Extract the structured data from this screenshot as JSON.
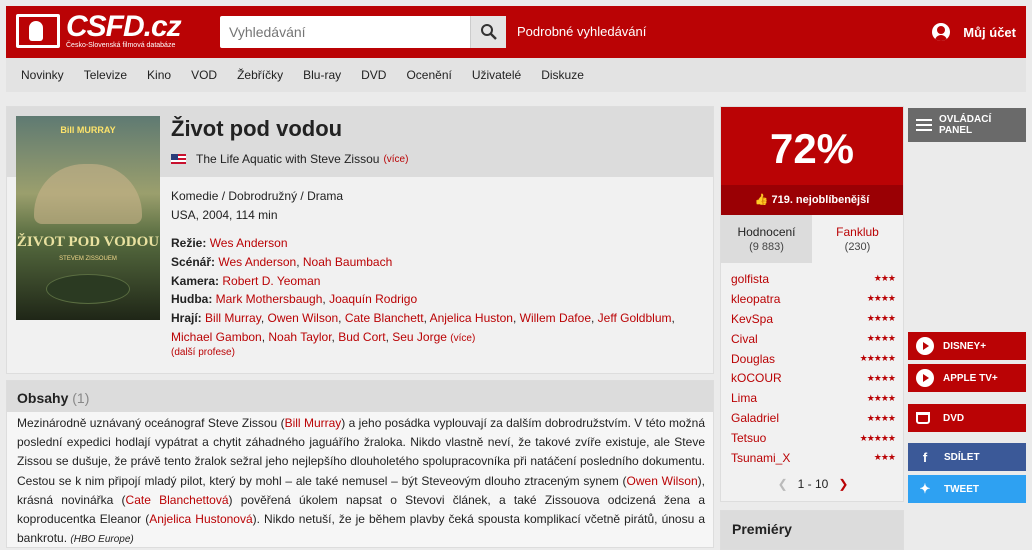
{
  "header": {
    "logo_text": "CSFD.cz",
    "logo_tagline": "Česko-Slovenská filmová databáze",
    "search_placeholder": "Vyhledávání",
    "advanced_search": "Podrobné vyhledávání",
    "account": "Můj účet",
    "accent_color": "#ba0305"
  },
  "nav": [
    "Novinky",
    "Televize",
    "Kino",
    "VOD",
    "Žebříčky",
    "Blu-ray",
    "DVD",
    "Ocenění",
    "Uživatelé",
    "Diskuze"
  ],
  "film": {
    "title": "Život pod vodou",
    "original_title": "The Life Aquatic with Steve Zissou",
    "more": "(více)",
    "genres": "Komedie / Dobrodružný / Drama",
    "origin": "USA, 2004, 114 min",
    "poster": {
      "actor": "Bill MURRAY",
      "title": "ŽIVOT POD VODOU",
      "subtitle": "STEVEM ZISSOUEM"
    },
    "crew": {
      "director_label": "Režie:",
      "directors": [
        "Wes Anderson"
      ],
      "writer_label": "Scénář:",
      "writers": [
        "Wes Anderson",
        "Noah Baumbach"
      ],
      "camera_label": "Kamera:",
      "camera": [
        "Robert D. Yeoman"
      ],
      "music_label": "Hudba:",
      "music": [
        "Mark Mothersbaugh",
        "Joaquín Rodrigo"
      ],
      "cast_label": "Hrají:",
      "cast": [
        "Bill Murray",
        "Owen Wilson",
        "Cate Blanchett",
        "Anjelica Huston",
        "Willem Dafoe",
        "Jeff Goldblum",
        "Michael Gambon",
        "Noah Taylor",
        "Bud Cort",
        "Seu Jorge"
      ],
      "cast_more": "(více)",
      "more_professions": "(další profese)"
    }
  },
  "plot": {
    "heading": "Obsahy",
    "count": "(1)",
    "p1": "Mezinárodně uznávaný oceánograf Steve Zissou (",
    "l1": "Bill Murray",
    "p2": ") a jeho posádka vyplouvají za dalším dobrodružstvím. V této možná poslední expedici hodlají vypátrat a chytit záhadného jaguářího žraloka. Nikdo vlastně neví, že takové zvíře existuje, ale Steve Zissou se dušuje, že právě tento žralok sežral jeho nejlepšího dlouholetého spolupracovníka při natáčení posledního dokumentu. Cestou se k nim připojí mladý pilot, který by mohl – ale také nemusel – být Steveovým dlouho ztraceným synem (",
    "l2": "Owen Wilson",
    "p3": "), krásná novinářka (",
    "l3": "Cate Blanchettová",
    "p4": ") pověřená úkolem napsat o Stevovi článek, a také Zissouova odcizená žena a koproducentka Eleanor (",
    "l4": "Anjelica Hustonová",
    "p5": "). Nikdo netuší, že je během plavby čeká spousta komplikací včetně pirátů, únosu a bankrotu.",
    "source": "(HBO Europe)"
  },
  "rating": {
    "percent": "72%",
    "rank": "719. nejoblíbenější",
    "tab_ratings": "Hodnocení",
    "tab_ratings_count": "(9 883)",
    "tab_fanclub": "Fanklub",
    "tab_fanclub_count": "(230)",
    "users": [
      {
        "name": "golfista",
        "stars": 3
      },
      {
        "name": "kleopatra",
        "stars": 4
      },
      {
        "name": "KevSpa",
        "stars": 4
      },
      {
        "name": "Cival",
        "stars": 4
      },
      {
        "name": "Douglas",
        "stars": 5
      },
      {
        "name": "kOCOUR",
        "stars": 4
      },
      {
        "name": "Lima",
        "stars": 4
      },
      {
        "name": "Galadriel",
        "stars": 4
      },
      {
        "name": "Tetsuo",
        "stars": 5
      },
      {
        "name": "Tsunami_X",
        "stars": 3
      }
    ],
    "pager": "1 - 10"
  },
  "premiery": "Premiéry",
  "sidebar": {
    "panel": "OVLÁDACÍ PANEL",
    "disney": "DISNEY+",
    "apple": "APPLE TV+",
    "dvd": "DVD",
    "share": "SDÍLET",
    "tweet": "TWEET",
    "facebook_color": "#3b5998",
    "twitter_color": "#2ea1f2"
  }
}
